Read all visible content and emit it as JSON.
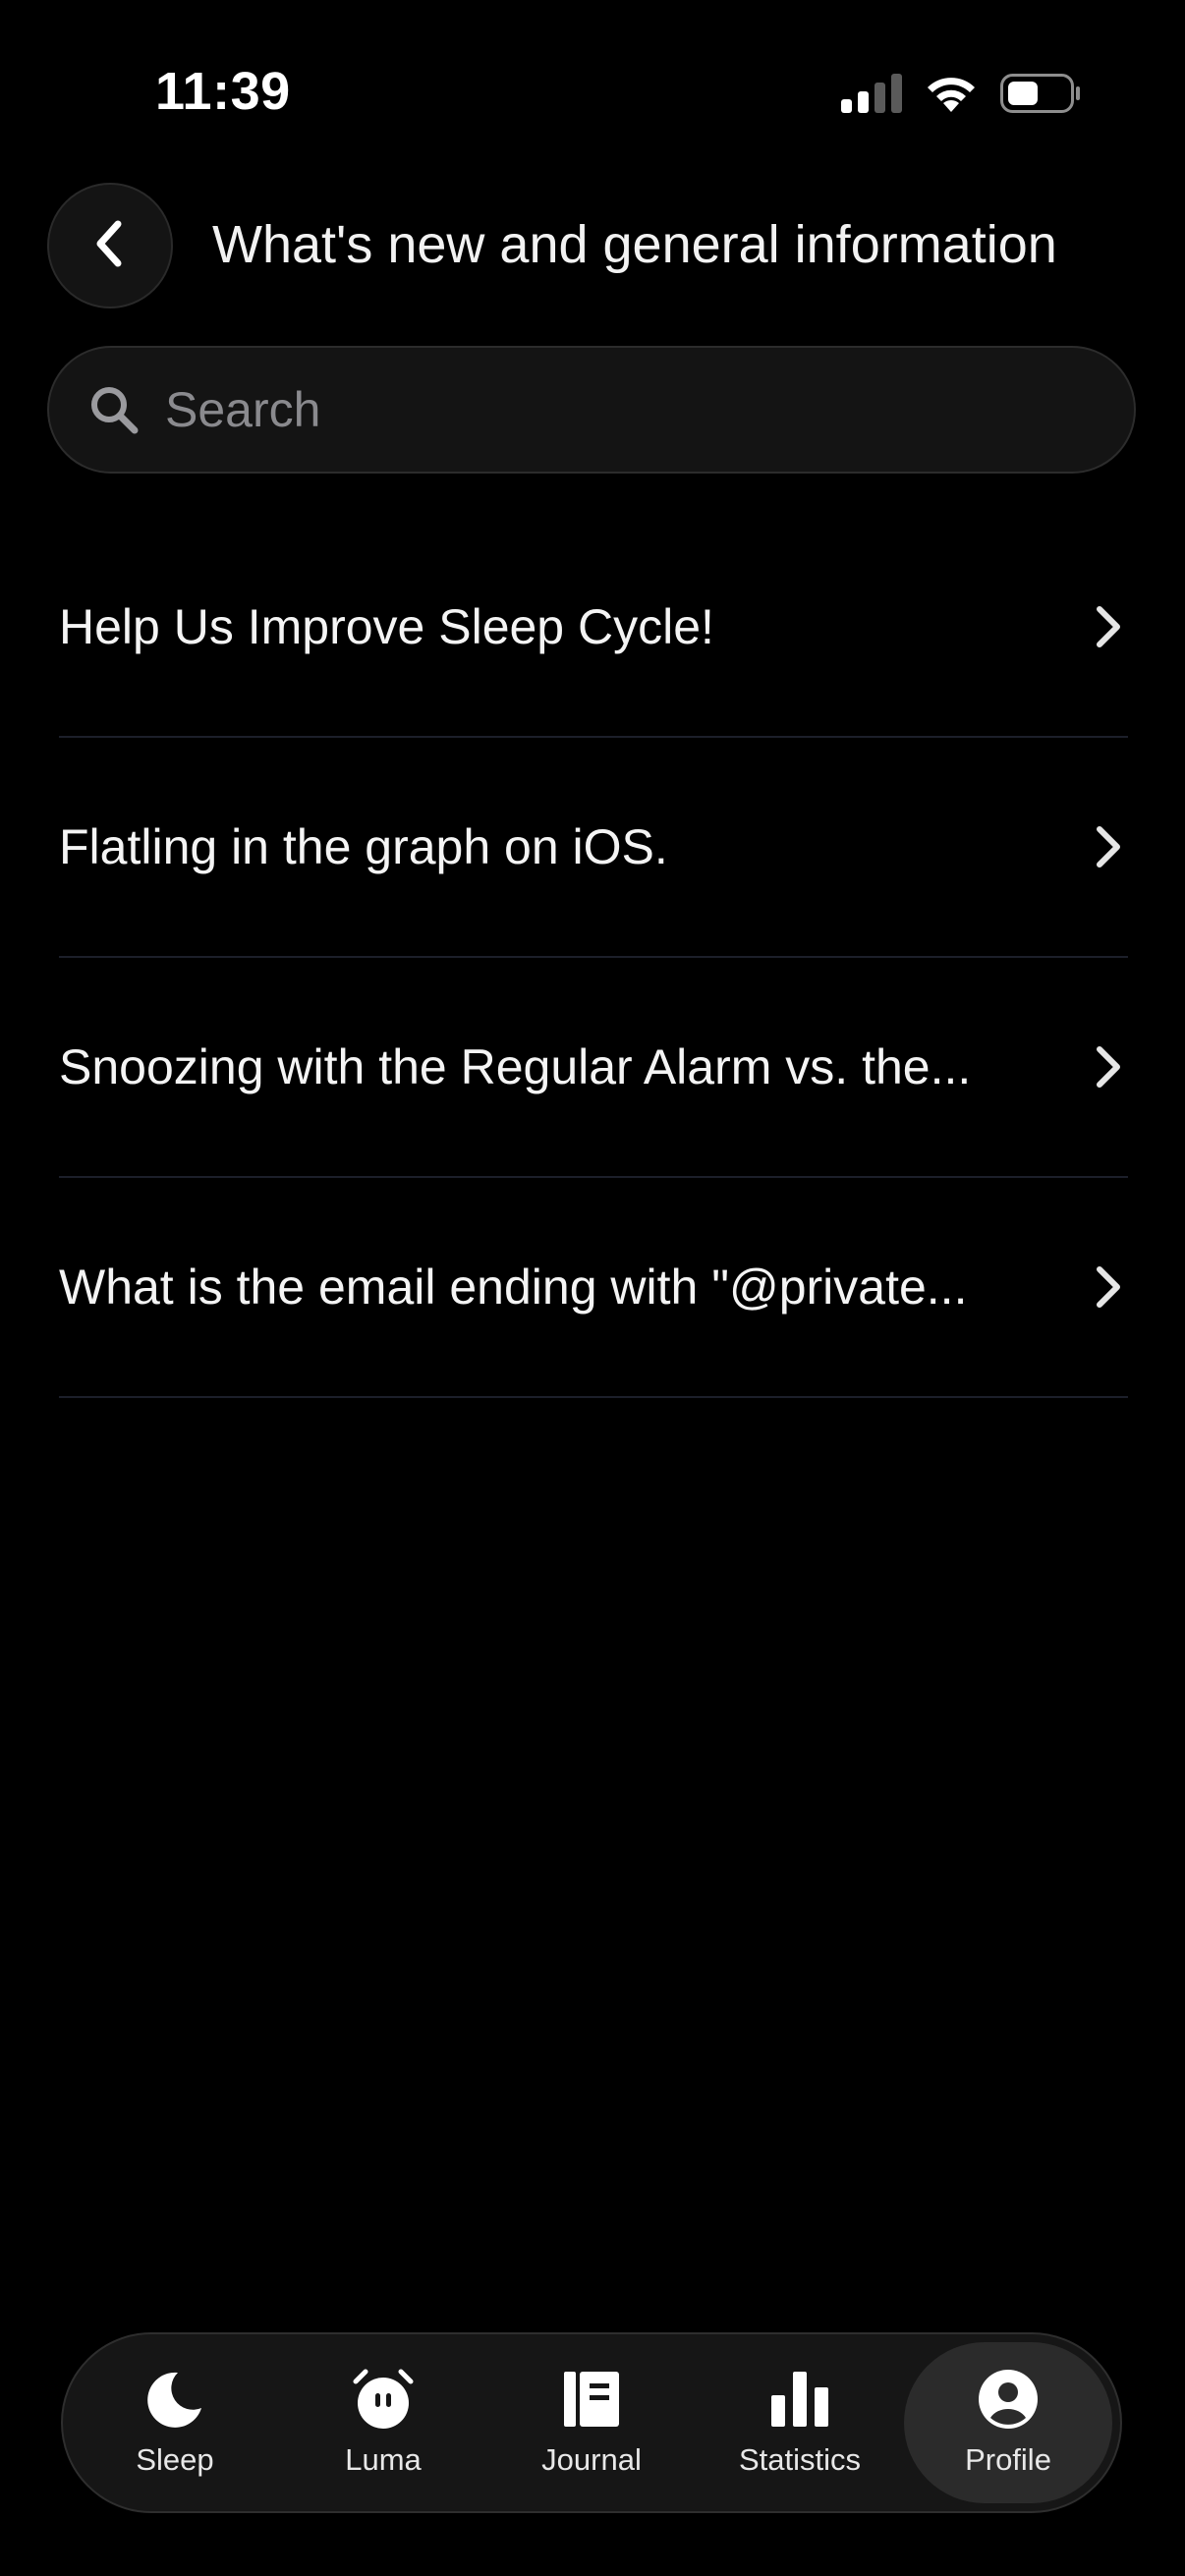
{
  "status_bar": {
    "time": "11:39",
    "icons": [
      "cellular-signal-icon",
      "wifi-icon",
      "battery-icon"
    ]
  },
  "header": {
    "back_icon": "chevron-left-icon",
    "title": "What's new and general information"
  },
  "search": {
    "placeholder": "Search",
    "value": "",
    "icon": "search-icon"
  },
  "articles": [
    {
      "label": "Help Us Improve Sleep Cycle!"
    },
    {
      "label": "Flatling in the graph on iOS."
    },
    {
      "label": "Snoozing with the Regular Alarm vs. the..."
    },
    {
      "label": "What is the email ending with \"@private..."
    }
  ],
  "tab_bar": {
    "tabs": [
      {
        "label": "Sleep",
        "icon": "moon-icon",
        "active": false
      },
      {
        "label": "Luma",
        "icon": "alarm-clock-icon",
        "active": false
      },
      {
        "label": "Journal",
        "icon": "journal-icon",
        "active": false
      },
      {
        "label": "Statistics",
        "icon": "bar-chart-icon",
        "active": false
      },
      {
        "label": "Profile",
        "icon": "profile-icon",
        "active": true
      }
    ]
  },
  "colors": {
    "background": "#000000",
    "surface": "#141414",
    "active_tab": "#2b2b2b",
    "divider": "#1c1f2a",
    "placeholder": "#8a8a8e",
    "text": "#f4f4f4"
  }
}
